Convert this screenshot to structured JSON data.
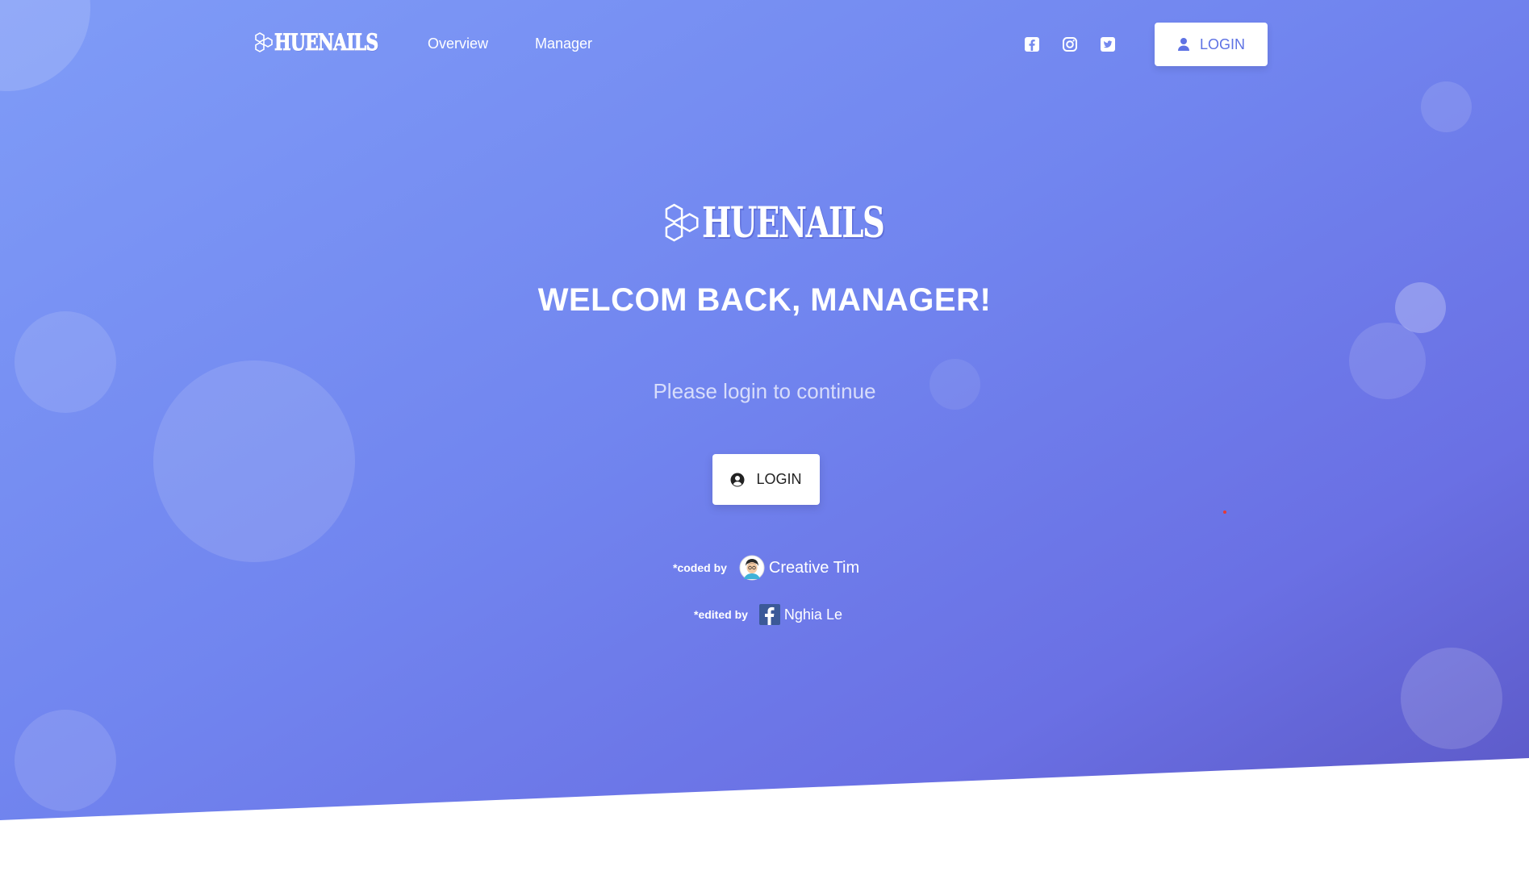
{
  "nav": {
    "brand": "HUENAILS",
    "links": [
      {
        "label": "Overview"
      },
      {
        "label": "Manager"
      }
    ],
    "social": [
      "facebook-square-icon",
      "instagram-icon",
      "twitter-square-icon"
    ],
    "login_label": "LOGIN"
  },
  "main": {
    "brand": "HUENAILS",
    "headline": "WELCOM BACK, MANAGER!",
    "subline": "Please login to continue",
    "login_label": "LOGIN"
  },
  "credits": {
    "coded_prefix": "*coded by",
    "coded_name": "Creative Tim",
    "edited_prefix": "*edited by",
    "edited_name": "Nghia Le"
  },
  "colors": {
    "accent": "#5e72e4",
    "gradient_start": "#7f9cf7",
    "gradient_end": "#5a55c2"
  }
}
